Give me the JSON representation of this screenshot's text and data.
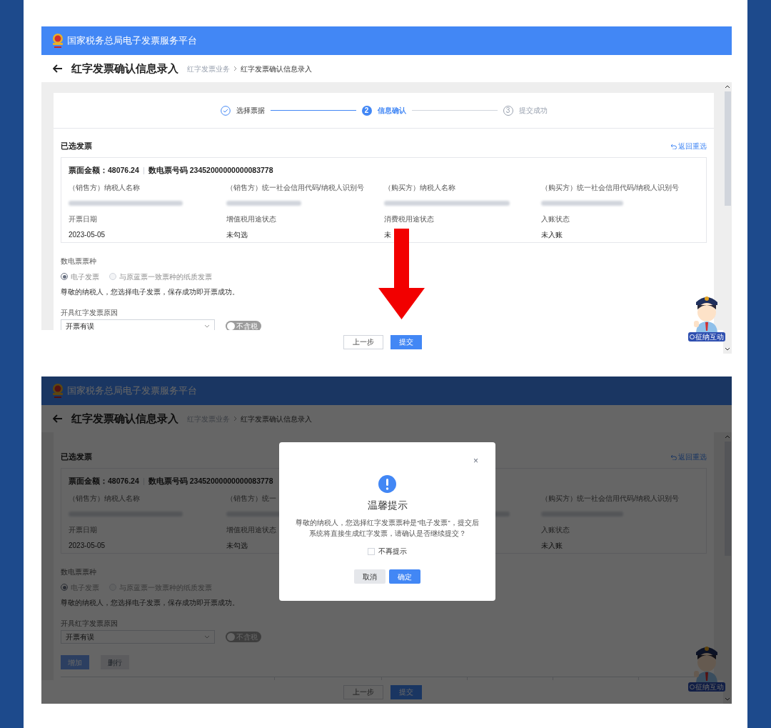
{
  "frames": [
    {
      "header_title": "国家税务总局电子发票服务平台",
      "page_title": "红字发票确认信息录入",
      "breadcrumb": [
        "红字发票业务",
        "红字发票确认信息录入"
      ],
      "steps": [
        {
          "label": "选择票据",
          "completed": true,
          "selected": false
        },
        {
          "label": "信息确认",
          "number": "2",
          "completed": false,
          "selected": true
        },
        {
          "label": "提交成功",
          "number": "3",
          "completed": false,
          "selected": false
        }
      ],
      "section_title": "已选发票",
      "back_link": "返回重选",
      "invoice": {
        "amount": "票面金额：48076.24",
        "number": "数电票号码 23452000000000083778",
        "fields": [
          {
            "kind": "label",
            "text": "（销售方）纳税人名称"
          },
          {
            "kind": "label",
            "text": "（销售方）统一社会信用代码/纳税人识别号"
          },
          {
            "kind": "label",
            "text": "（购买方）纳税人名称"
          },
          {
            "kind": "label",
            "text": "（购买方）统一社会信用代码/纳税人识别号"
          },
          {
            "kind": "blurred"
          },
          {
            "kind": "blurred"
          },
          {
            "kind": "blurred"
          },
          {
            "kind": "blurred"
          },
          {
            "kind": "label",
            "text": "开票日期"
          },
          {
            "kind": "label",
            "text": "增值税用途状态"
          },
          {
            "kind": "label",
            "text": "消费税用途状态"
          },
          {
            "kind": "label",
            "text": "入账状态"
          },
          {
            "kind": "value",
            "text": "2023-05-05"
          },
          {
            "kind": "value",
            "text": "未勾选"
          },
          {
            "kind": "value",
            "text": "未"
          },
          {
            "kind": "value",
            "text": "未入账"
          }
        ]
      },
      "ticket_type": {
        "label": "数电票票种",
        "options": [
          {
            "label": "电子发票",
            "selected": true,
            "disabled": true
          },
          {
            "label": "与原蓝票一致票种的纸质发票",
            "selected": false,
            "disabled": true
          }
        ]
      },
      "notice": "尊敬的纳税人，您选择电子发票，保存成功即开票成功。",
      "reason": {
        "label": "开具红字发票原因",
        "value": "开票有误"
      },
      "tax_toggle": {
        "label": "不含税",
        "on": false
      },
      "footer_buttons": [
        {
          "label": "上一步",
          "primary": false
        },
        {
          "label": "提交",
          "primary": true
        }
      ],
      "mascot_badge": "征纳互动",
      "arrow_annotation": true
    },
    {
      "header_title": "国家税务总局电子发票服务平台",
      "page_title": "红字发票确认信息录入",
      "breadcrumb": [
        "红字发票业务",
        "红字发票确认信息录入"
      ],
      "section_title": "已选发票",
      "back_link": "返回重选",
      "invoice": {
        "amount": "票面金额：48076.24",
        "number": "数电票号码 23452000000000083778",
        "fields": [
          {
            "kind": "label",
            "text": "（销售方）纳税人名称"
          },
          {
            "kind": "label",
            "text": "（销售方）统一"
          },
          {
            "kind": "covered"
          },
          {
            "kind": "label",
            "text": "（购买方）统一社会信用代码/纳税人识别号"
          },
          {
            "kind": "blurred"
          },
          {
            "kind": "blurred"
          },
          {
            "kind": "blurred"
          },
          {
            "kind": "blurred"
          },
          {
            "kind": "label",
            "text": "开票日期"
          },
          {
            "kind": "label",
            "text": "增值税用途状态"
          },
          {
            "kind": "covered"
          },
          {
            "kind": "label",
            "text": "入账状态"
          },
          {
            "kind": "value",
            "text": "2023-05-05"
          },
          {
            "kind": "value",
            "text": "未勾选"
          },
          {
            "kind": "covered"
          },
          {
            "kind": "value",
            "text": "未入账"
          }
        ]
      },
      "ticket_type": {
        "label": "数电票票种",
        "options": [
          {
            "label": "电子发票",
            "selected": true,
            "disabled": true
          },
          {
            "label": "与原蓝票一致票种的纸质发票",
            "selected": false,
            "disabled": true
          }
        ]
      },
      "notice": "尊敬的纳税人，您选择电子发票，保存成功即开票成功。",
      "reason": {
        "label": "开具红字发票原因",
        "value": "开票有误"
      },
      "tax_toggle": {
        "label": "不含税",
        "on": false
      },
      "row_buttons": [
        {
          "label": "增加",
          "disabled": false
        },
        {
          "label": "删行",
          "disabled": true
        }
      ],
      "footer_buttons": [
        {
          "label": "上一步",
          "primary": false
        },
        {
          "label": "提交",
          "primary": true
        }
      ],
      "mascot_badge": "征纳互动",
      "dimmed": true,
      "dialog": {
        "close": "×",
        "title": "温馨提示",
        "message": "尊敬的纳税人，您选择红字发票票种是“电子发票”，提交后系统将直接生成红字发票，请确认是否继续提交？",
        "checkbox": {
          "label": "不再提示",
          "checked": false
        },
        "buttons": [
          {
            "label": "取消",
            "primary": false
          },
          {
            "label": "确定",
            "primary": true
          }
        ]
      }
    }
  ]
}
